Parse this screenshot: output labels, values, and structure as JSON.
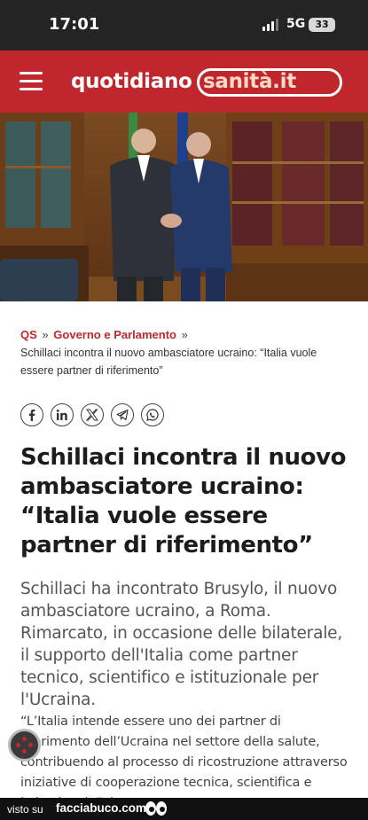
{
  "status_bar": {
    "time": "17:01",
    "network": "5G",
    "battery": "33"
  },
  "header": {
    "logo_main": "quotidiano",
    "logo_accent": "sanità.it"
  },
  "breadcrumb": {
    "home": "QS",
    "separator": "»",
    "section": "Governo e Parlamento",
    "current": "Schillaci incontra il nuovo ambasciatore ucraino: “Italia vuole essere partner di riferimento”"
  },
  "share": {
    "icons": [
      "facebook-icon",
      "linkedin-icon",
      "x-icon",
      "telegram-icon",
      "whatsapp-icon"
    ]
  },
  "article": {
    "headline": "Schillaci incontra il nuovo ambasciatore ucraino: “Italia vuole essere partner di riferimento”",
    "lead": "Schillaci ha incontrato Brusylo, il nuovo ambasciatore ucraino, a Roma. Rimarcato, in occasione delle bilaterale, il supporto dell'Italia come partner tecnico, scientifico e istituzionale per l'Ucraina.",
    "body": "“L’Italia intende essere uno dei partner di riferimento dell’Ucraina nel settore della salute, contribuendo al processo di ricostruzione attraverso iniziative di cooperazione tecnica, scientifica e istituzionale”, lo"
  },
  "watermark": {
    "prefix": "visto su",
    "site": "facciabuco.com"
  },
  "colors": {
    "brand_red": "#c0272d",
    "status_bar": "#242424",
    "headline": "#1c1c1c",
    "lead": "#555555"
  }
}
